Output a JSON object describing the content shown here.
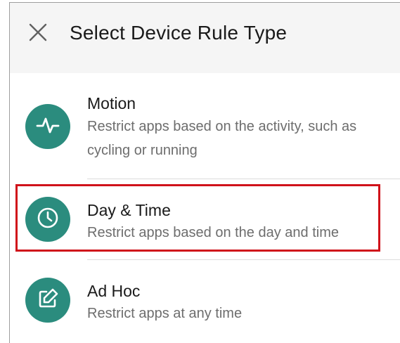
{
  "header": {
    "title": "Select Device Rule Type",
    "close_icon": "close-icon"
  },
  "rule_types": [
    {
      "title": "Motion",
      "description": "Restrict apps based on the activity, such as cycling or running",
      "icon": "activity-pulse-icon"
    },
    {
      "title": "Day & Time",
      "description": "Restrict apps based on the day and time",
      "icon": "clock-icon",
      "highlighted": true
    },
    {
      "title": "Ad Hoc",
      "description": "Restrict apps at any time",
      "icon": "edit-icon"
    }
  ],
  "colors": {
    "accent": "#2b8c7e",
    "highlight": "#d0121a",
    "header_bg": "#f5f5f5"
  }
}
